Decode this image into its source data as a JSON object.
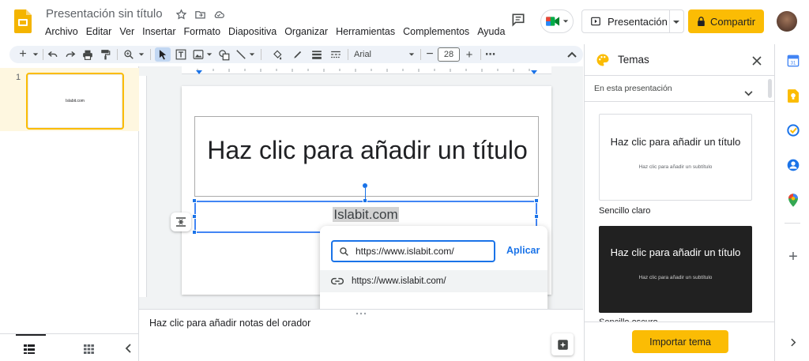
{
  "header": {
    "doc_title": "Presentación sin título",
    "menu": [
      "Archivo",
      "Editar",
      "Ver",
      "Insertar",
      "Formato",
      "Diapositiva",
      "Organizar",
      "Herramientas",
      "Complementos",
      "Ayuda"
    ],
    "present_label": "Presentación",
    "share_label": "Compartir"
  },
  "toolbar": {
    "font": "Arial",
    "font_size": "28"
  },
  "filmstrip": {
    "slides": [
      {
        "number": "1",
        "thumb_text": "Islabit.com"
      }
    ]
  },
  "slide": {
    "title": "Haz clic para añadir un título",
    "subtitle": "Islabit.com"
  },
  "link_popup": {
    "input_value": "https://www.islabit.com/",
    "apply_label": "Aplicar",
    "suggestion": "https://www.islabit.com/"
  },
  "notes": {
    "placeholder": "Haz clic para añadir notas del orador"
  },
  "themes_panel": {
    "title": "Temas",
    "section": "En esta presentación",
    "themes": [
      {
        "name": "Sencillo claro",
        "preview_title": "Haz clic para añadir un título",
        "preview_subtitle": "Haz clic para añadir un subtítulo"
      },
      {
        "name": "Sencillo oscuro",
        "preview_title": "Haz clic para añadir un título",
        "preview_subtitle": "Haz clic para añadir un subtítulo"
      }
    ],
    "import_label": "Importar tema"
  },
  "colors": {
    "accent_yellow": "#fbbc04",
    "selection_blue": "#1a73e8",
    "dark_theme_bg": "#212121"
  },
  "icons": {
    "side_panel": [
      "calendar-icon",
      "keep-icon",
      "tasks-icon",
      "contacts-icon",
      "maps-icon",
      "add-icon"
    ]
  }
}
